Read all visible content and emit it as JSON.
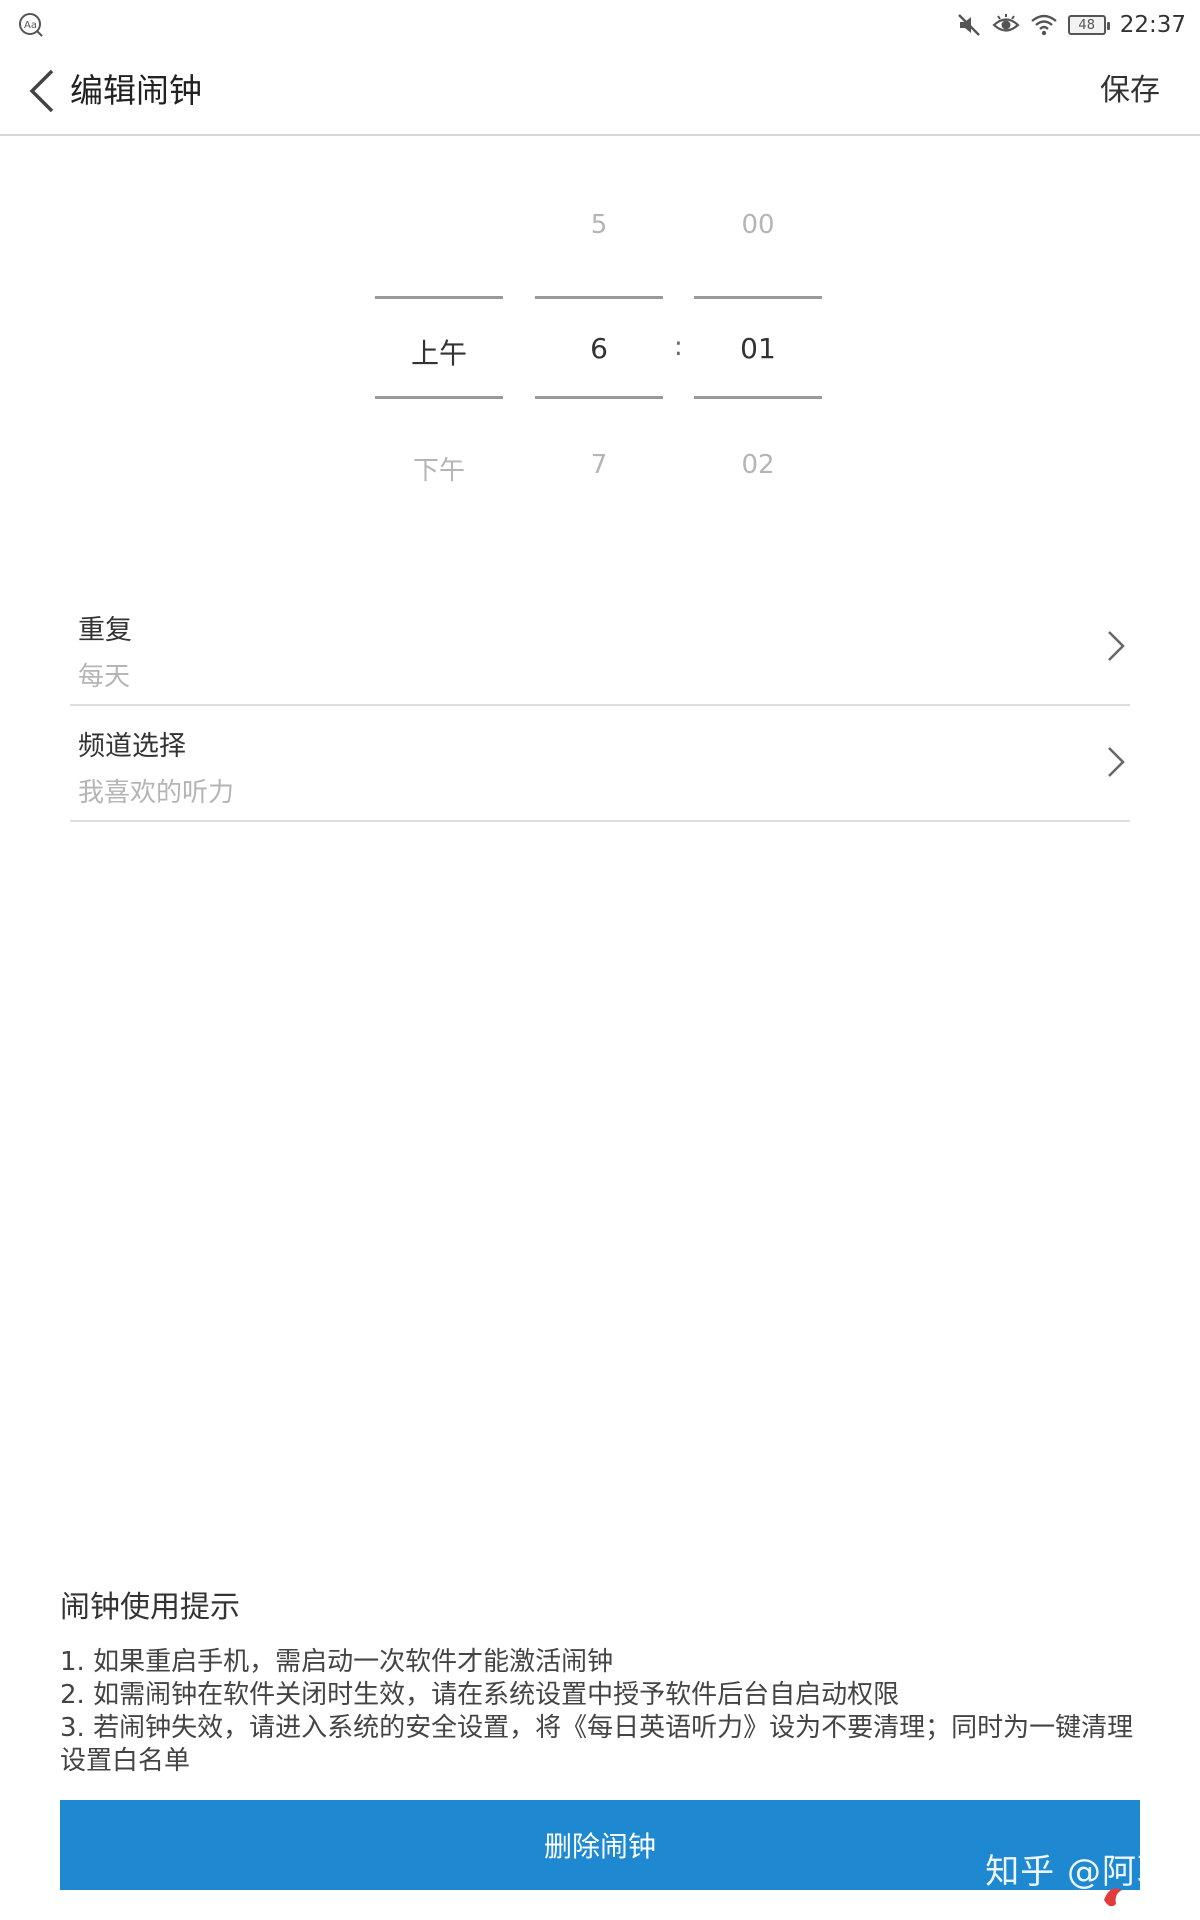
{
  "status_bar": {
    "left_icon": "text-size-icon",
    "right_icons": [
      "mute-icon",
      "eye-icon",
      "wifi-icon"
    ],
    "battery": "48",
    "time": "22:37"
  },
  "header": {
    "back_icon": "chevron-left-icon",
    "title": "编辑闹钟",
    "save_label": "保存"
  },
  "time_picker": {
    "period": {
      "above": "",
      "selected": "上午",
      "below": "下午"
    },
    "hour": {
      "above": "5",
      "selected": "6",
      "below": "7"
    },
    "minute": {
      "above": "00",
      "selected": "01",
      "below": "02"
    },
    "separator": ":"
  },
  "settings": [
    {
      "title": "重复",
      "value": "每天"
    },
    {
      "title": "频道选择",
      "value": "我喜欢的听力"
    }
  ],
  "tips": {
    "title": "闹钟使用提示",
    "lines": [
      "1. 如果重启手机，需启动一次软件才能激活闹钟",
      "2. 如需闹钟在软件关闭时生效，请在系统设置中授予软件后台自启动权限",
      "3. 若闹钟失效，请进入系统的安全设置，将《每日英语听力》设为不要清理；同时为一键清理设置白名单"
    ]
  },
  "delete_button": {
    "label": "删除闹钟"
  },
  "watermark": {
    "text": "知乎 @阿聪"
  },
  "colors": {
    "primary_button": "#1e88d0",
    "faded_text": "#b5b5b5",
    "divider": "#dedede"
  }
}
